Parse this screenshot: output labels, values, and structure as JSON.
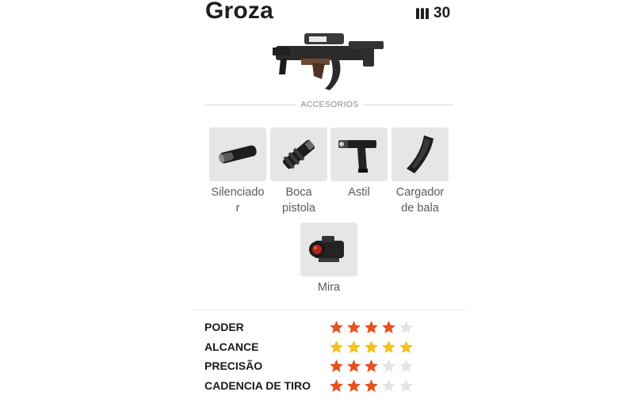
{
  "weapon": {
    "name": "Groza",
    "ammo_count": "30"
  },
  "icons": {
    "ammo": "bullets-icon",
    "weapon": "rifle-icon"
  },
  "attachments": {
    "section_label": "ACCESORIOS",
    "items": [
      {
        "label": "Silenciado\nr",
        "icon": "silencer-icon"
      },
      {
        "label": "Boca\npistola",
        "icon": "muzzle-icon"
      },
      {
        "label": "Astil",
        "icon": "grip-icon"
      },
      {
        "label": "Cargador\nde bala",
        "icon": "magazine-icon"
      },
      {
        "label": "Mira",
        "icon": "scope-icon"
      }
    ]
  },
  "stats": [
    {
      "label": "PODER",
      "rating": 4,
      "max": 5,
      "color": "#e8501e"
    },
    {
      "label": "ALCANCE",
      "rating": 5,
      "max": 5,
      "color": "#f2c11a"
    },
    {
      "label": "PRECISÃO",
      "rating": 3,
      "max": 5,
      "color": "#e8501e"
    },
    {
      "label": "CADENCIA DE TIRO",
      "rating": 3,
      "max": 5,
      "color": "#e8501e"
    }
  ],
  "colors": {
    "empty_star": "#e4e4e4",
    "tile_bg": "#e6e6e6"
  }
}
